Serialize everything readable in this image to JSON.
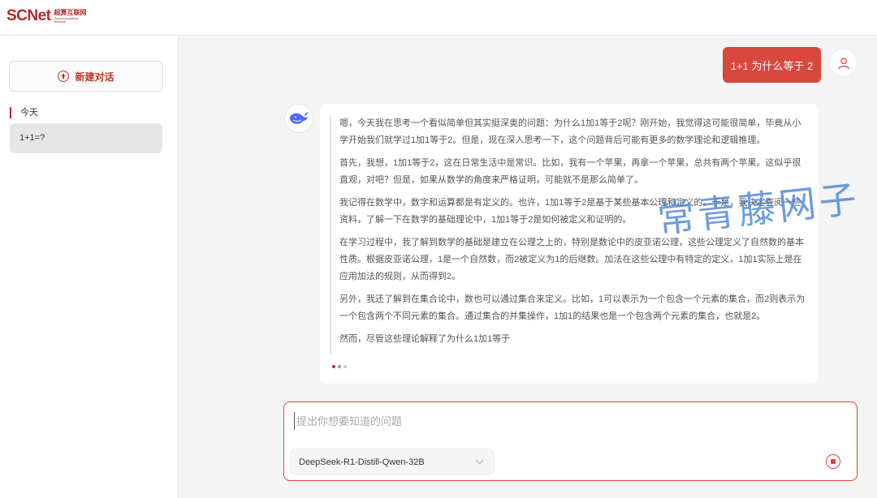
{
  "header": {
    "logo_main": "SCNet",
    "logo_cn": "超算互联网",
    "logo_en": "Supercomputing\nNetwork"
  },
  "sidebar": {
    "new_chat_label": "新建对话",
    "section_label": "今天",
    "history": [
      {
        "label": "1+1=?"
      }
    ]
  },
  "chat": {
    "user_message": "1+1 为什么等于 2",
    "assistant_paragraphs": [
      "嗯，今天我在思考一个看似简单但其实挺深奥的问题：为什么1加1等于2呢？刚开始，我觉得这可能很简单，毕竟从小学开始我们就学过1加1等于2。但是，现在深入思考一下，这个问题背后可能有更多的数学理论和逻辑推理。",
      "首先，我想，1加1等于2，这在日常生活中是常识。比如，我有一个苹果，再拿一个苹果，总共有两个苹果。这似乎很直观，对吧？但是，如果从数学的角度来严格证明，可能就不是那么简单了。",
      "我记得在数学中，数字和运算都是有定义的。也许，1加1等于2是基于某些基本公理和定义的。于是，我决定查阅一些资料，了解一下在数学的基础理论中，1加1等于2是如何被定义和证明的。",
      "在学习过程中，我了解到数学的基础是建立在公理之上的，特别是数论中的皮亚诺公理，这些公理定义了自然数的基本性质。根据皮亚诺公理，1是一个自然数，而2被定义为1的后继数。加法在这些公理中有特定的定义，1加1实际上是在应用加法的规则，从而得到2。",
      "另外，我还了解到在集合论中，数也可以通过集合来定义。比如，1可以表示为一个包含一个元素的集合，而2则表示为一个包含两个不同元素的集合。通过集合的并集操作，1加1的结果也是一个包含两个元素的集合，也就是2。",
      "然而，尽管这些理论解释了为什么1加1等于"
    ]
  },
  "watermark": "常青藤网子",
  "input": {
    "placeholder": "提出你想要知道的问题",
    "model": "DeepSeek-R1-Distill-Qwen-32B"
  },
  "colors": {
    "accent": "#d9473d",
    "brand": "#b3272d"
  }
}
